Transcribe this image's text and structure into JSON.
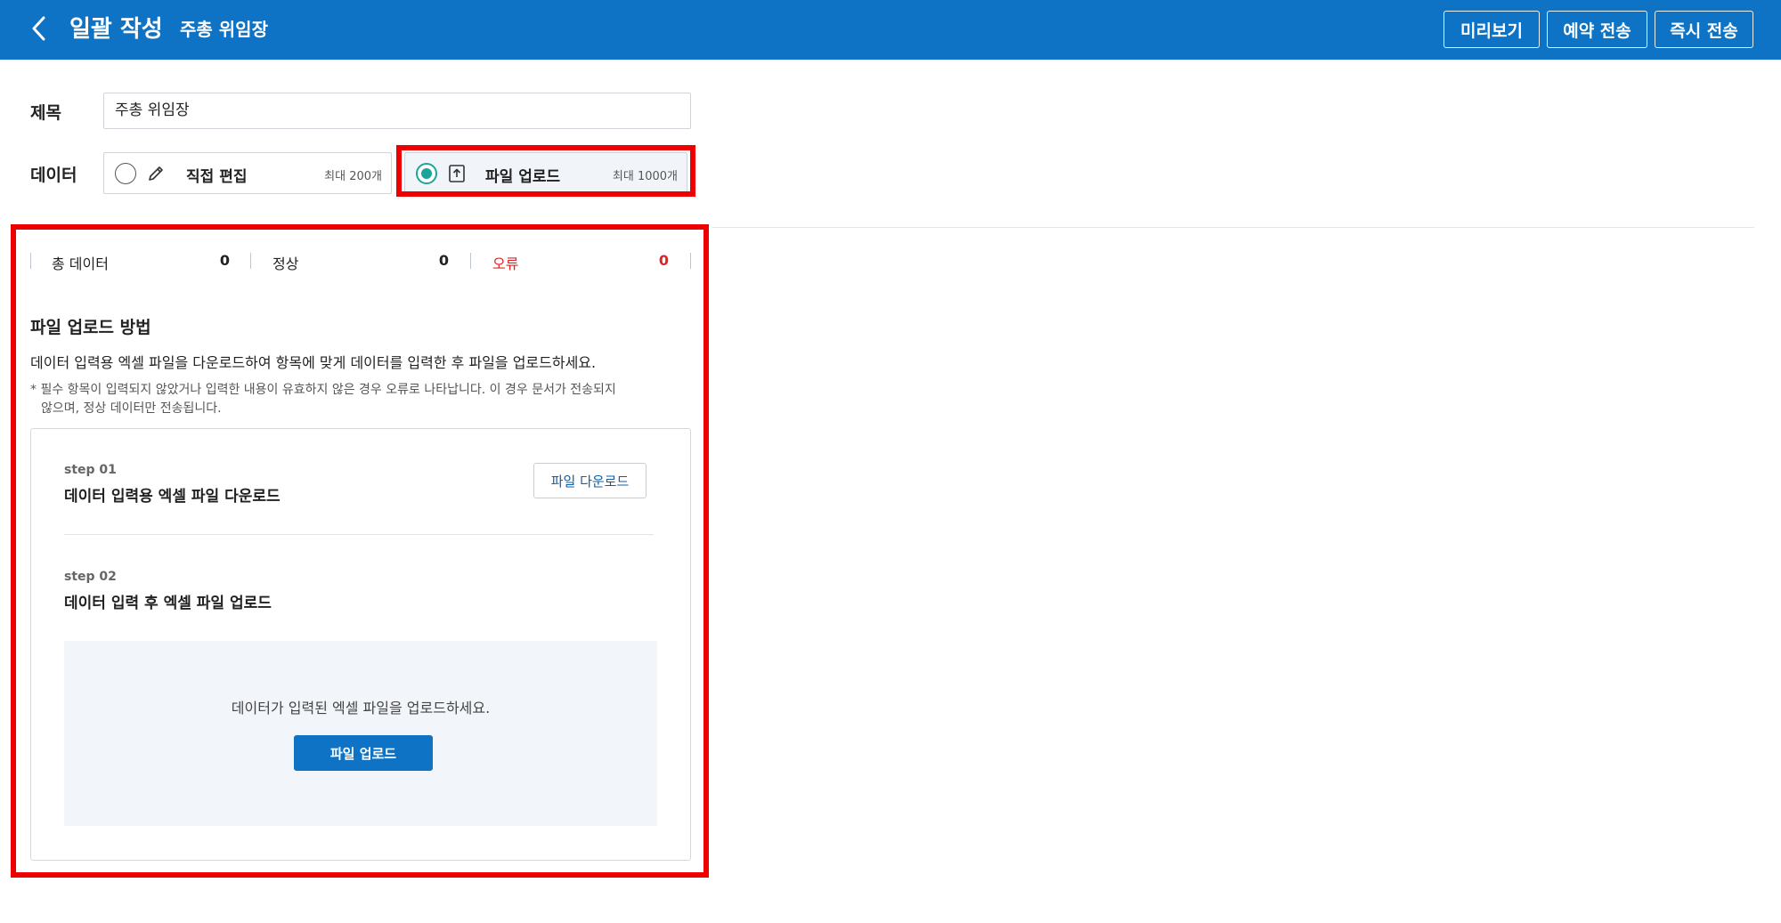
{
  "header": {
    "app_title": "일괄 작성",
    "doc_name": "주총 위임장",
    "buttons": {
      "preview": "미리보기",
      "reserve_send": "예약 전송",
      "instant_send": "즉시 전송"
    },
    "accent_color": "#0e73c4"
  },
  "form": {
    "title_label": "제목",
    "title_value": "주총 위임장",
    "data_label": "데이터",
    "options": [
      {
        "name": "직접 편집",
        "limit": "최대 200개",
        "icon": "pencil-icon",
        "selected": false
      },
      {
        "name": "파일 업로드",
        "limit": "최대 1000개",
        "icon": "upload-icon",
        "selected": true
      }
    ]
  },
  "stats": [
    {
      "name": "총 데이터",
      "value": "0"
    },
    {
      "name": "정상",
      "value": "0"
    },
    {
      "name": "오류",
      "value": "0",
      "color": "#e02424"
    }
  ],
  "method": {
    "title": "파일 업로드 방법",
    "description": "데이터 입력용 엑셀 파일을 다운로드하여 항목에 맞게 데이터를 입력한 후 파일을 업로드하세요.",
    "note_line1": "* 필수 항목이 입력되지 않았거나 입력한 내용이 유효하지 않은 경우 오류로 나타납니다. 이 경우 문서가 전송되지",
    "note_line2": "않으며, 정상 데이터만 전송됩니다."
  },
  "steps": [
    {
      "label": "step 01",
      "title": "데이터 입력용 엑셀 파일 다운로드",
      "button": "파일 다운로드"
    },
    {
      "label": "step 02",
      "title": "데이터 입력 후 엑셀 파일 업로드"
    }
  ],
  "dropzone": {
    "text": "데이터가 입력된 엑셀 파일을 업로드하세요.",
    "button": "파일 업로드"
  },
  "highlight_color": "#ee0000"
}
